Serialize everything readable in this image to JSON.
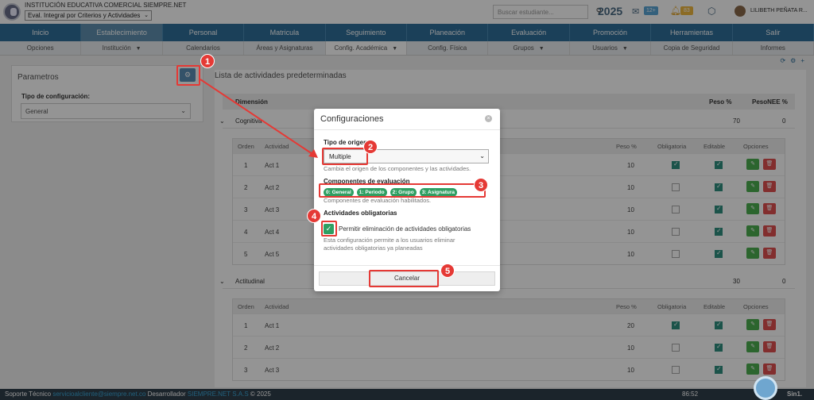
{
  "header": {
    "institution": "INSTITUCIÓN EDUCATIVA COMERCIAL SIEMPRE.NET",
    "plan_select": "Eval. Integral por Criterios y Actividades",
    "search_placeholder": "Buscar estudiante...",
    "year": "2025",
    "mail_count": "12+",
    "notif_count": "83",
    "user": "LILIBETH PEÑATA R..."
  },
  "main_menu": [
    "Inicio",
    "Establecimiento",
    "Personal",
    "Matricula",
    "Seguimiento",
    "Planeación",
    "Evaluación",
    "Promoción",
    "Herramientas",
    "Salir"
  ],
  "sub_menu": [
    {
      "label": "Opciones",
      "dd": ""
    },
    {
      "label": "Institución",
      "dd": "▼"
    },
    {
      "label": "Calendarios",
      "dd": ""
    },
    {
      "label": "Áreas y Asignaturas",
      "dd": ""
    },
    {
      "label": "Config. Académica",
      "dd": "▼"
    },
    {
      "label": "Config. Física",
      "dd": ""
    },
    {
      "label": "Grupos",
      "dd": "▼"
    },
    {
      "label": "Usuarios",
      "dd": "▼"
    },
    {
      "label": "Copia de Seguridad",
      "dd": ""
    },
    {
      "label": "Informes",
      "dd": ""
    }
  ],
  "left_panel": {
    "title": "Parametros",
    "config_label": "Tipo de configuración:",
    "config_value": "General"
  },
  "list": {
    "title": "Lista de actividades predeterminadas",
    "col_dimension": "Dimensión",
    "col_peso": "Peso %",
    "col_pesonee": "PesoNEE %",
    "act_cols": [
      "Orden",
      "Actividad",
      "Peso %",
      "Obligatoria",
      "Editable",
      "Opciones"
    ],
    "dimensions": [
      {
        "name": "Cognitiva",
        "peso": "70",
        "pesonee": "0",
        "rows": [
          {
            "orden": "1",
            "act": "Act 1",
            "peso": "10",
            "oblig": true,
            "edit": true
          },
          {
            "orden": "2",
            "act": "Act 2",
            "peso": "10",
            "oblig": false,
            "edit": true
          },
          {
            "orden": "3",
            "act": "Act 3",
            "peso": "10",
            "oblig": false,
            "edit": true
          },
          {
            "orden": "4",
            "act": "Act 4",
            "peso": "10",
            "oblig": false,
            "edit": true
          },
          {
            "orden": "5",
            "act": "Act 5",
            "peso": "10",
            "oblig": false,
            "edit": true
          }
        ]
      },
      {
        "name": "Actitudinal",
        "peso": "30",
        "pesonee": "0",
        "rows": [
          {
            "orden": "1",
            "act": "Act 1",
            "peso": "20",
            "oblig": true,
            "edit": true
          },
          {
            "orden": "2",
            "act": "Act 2",
            "peso": "10",
            "oblig": false,
            "edit": true
          },
          {
            "orden": "3",
            "act": "Act 3",
            "peso": "10",
            "oblig": false,
            "edit": true
          }
        ]
      }
    ]
  },
  "modal": {
    "title": "Configuraciones",
    "origin_label": "Tipo de origen",
    "origin_value": "Multiple",
    "origin_help": "Cambia el origen de los componentes y las actividades.",
    "components_label": "Componentes de evaluación",
    "components": [
      "0: General",
      "1: Periodo",
      "2: Grupo",
      "3: Asignatura"
    ],
    "components_help": "Componentes de evaluación habilitados.",
    "mandatory_label": "Actividades obligatorias",
    "permit_label": "Permitir eliminación de actividades obligatorias",
    "permit_help_1": "Esta configuración permite a los usuarios eliminar",
    "permit_help_2": "actividades obligatorias ya planeadas",
    "cancel": "Cancelar"
  },
  "annotations": [
    "1",
    "2",
    "3",
    "4",
    "5"
  ],
  "footer": {
    "support": "Soporte Técnico",
    "email": "servicioalcliente@siempre.net.co",
    "dev_label": "Desarrollador",
    "dev": "SIEMPRE.NET S.A.S",
    "copyright": "© 2025",
    "clock": "86:52",
    "brand": "Sin1."
  },
  "colors": {
    "primary": "#2f6f9a",
    "annotation": "#e53935",
    "tag": "#2e9f62"
  }
}
